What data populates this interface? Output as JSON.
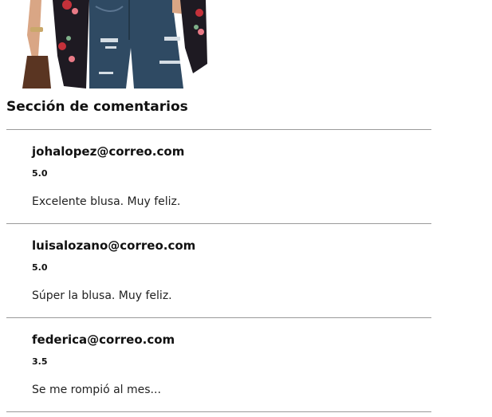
{
  "product": {
    "image_alt": "blusa",
    "colors": {
      "jeans": "#2f4a63",
      "jacket": "#1e1a22",
      "skin": "#d9a685",
      "floral_red": "#c4313a",
      "floral_pink": "#e97a86",
      "bag": "#5a3522"
    }
  },
  "comments_section": {
    "title": "Sección de comentarios",
    "divider_color": "#9a9a9a",
    "items": [
      {
        "email": "johalopez@correo.com",
        "rating": "5.0",
        "text": "Excelente blusa. Muy feliz."
      },
      {
        "email": "luisalozano@correo.com",
        "rating": "5.0",
        "text": "Súper la blusa. Muy feliz."
      },
      {
        "email": "federica@correo.com",
        "rating": "3.5",
        "text": "Se me rompió al mes..."
      }
    ]
  }
}
